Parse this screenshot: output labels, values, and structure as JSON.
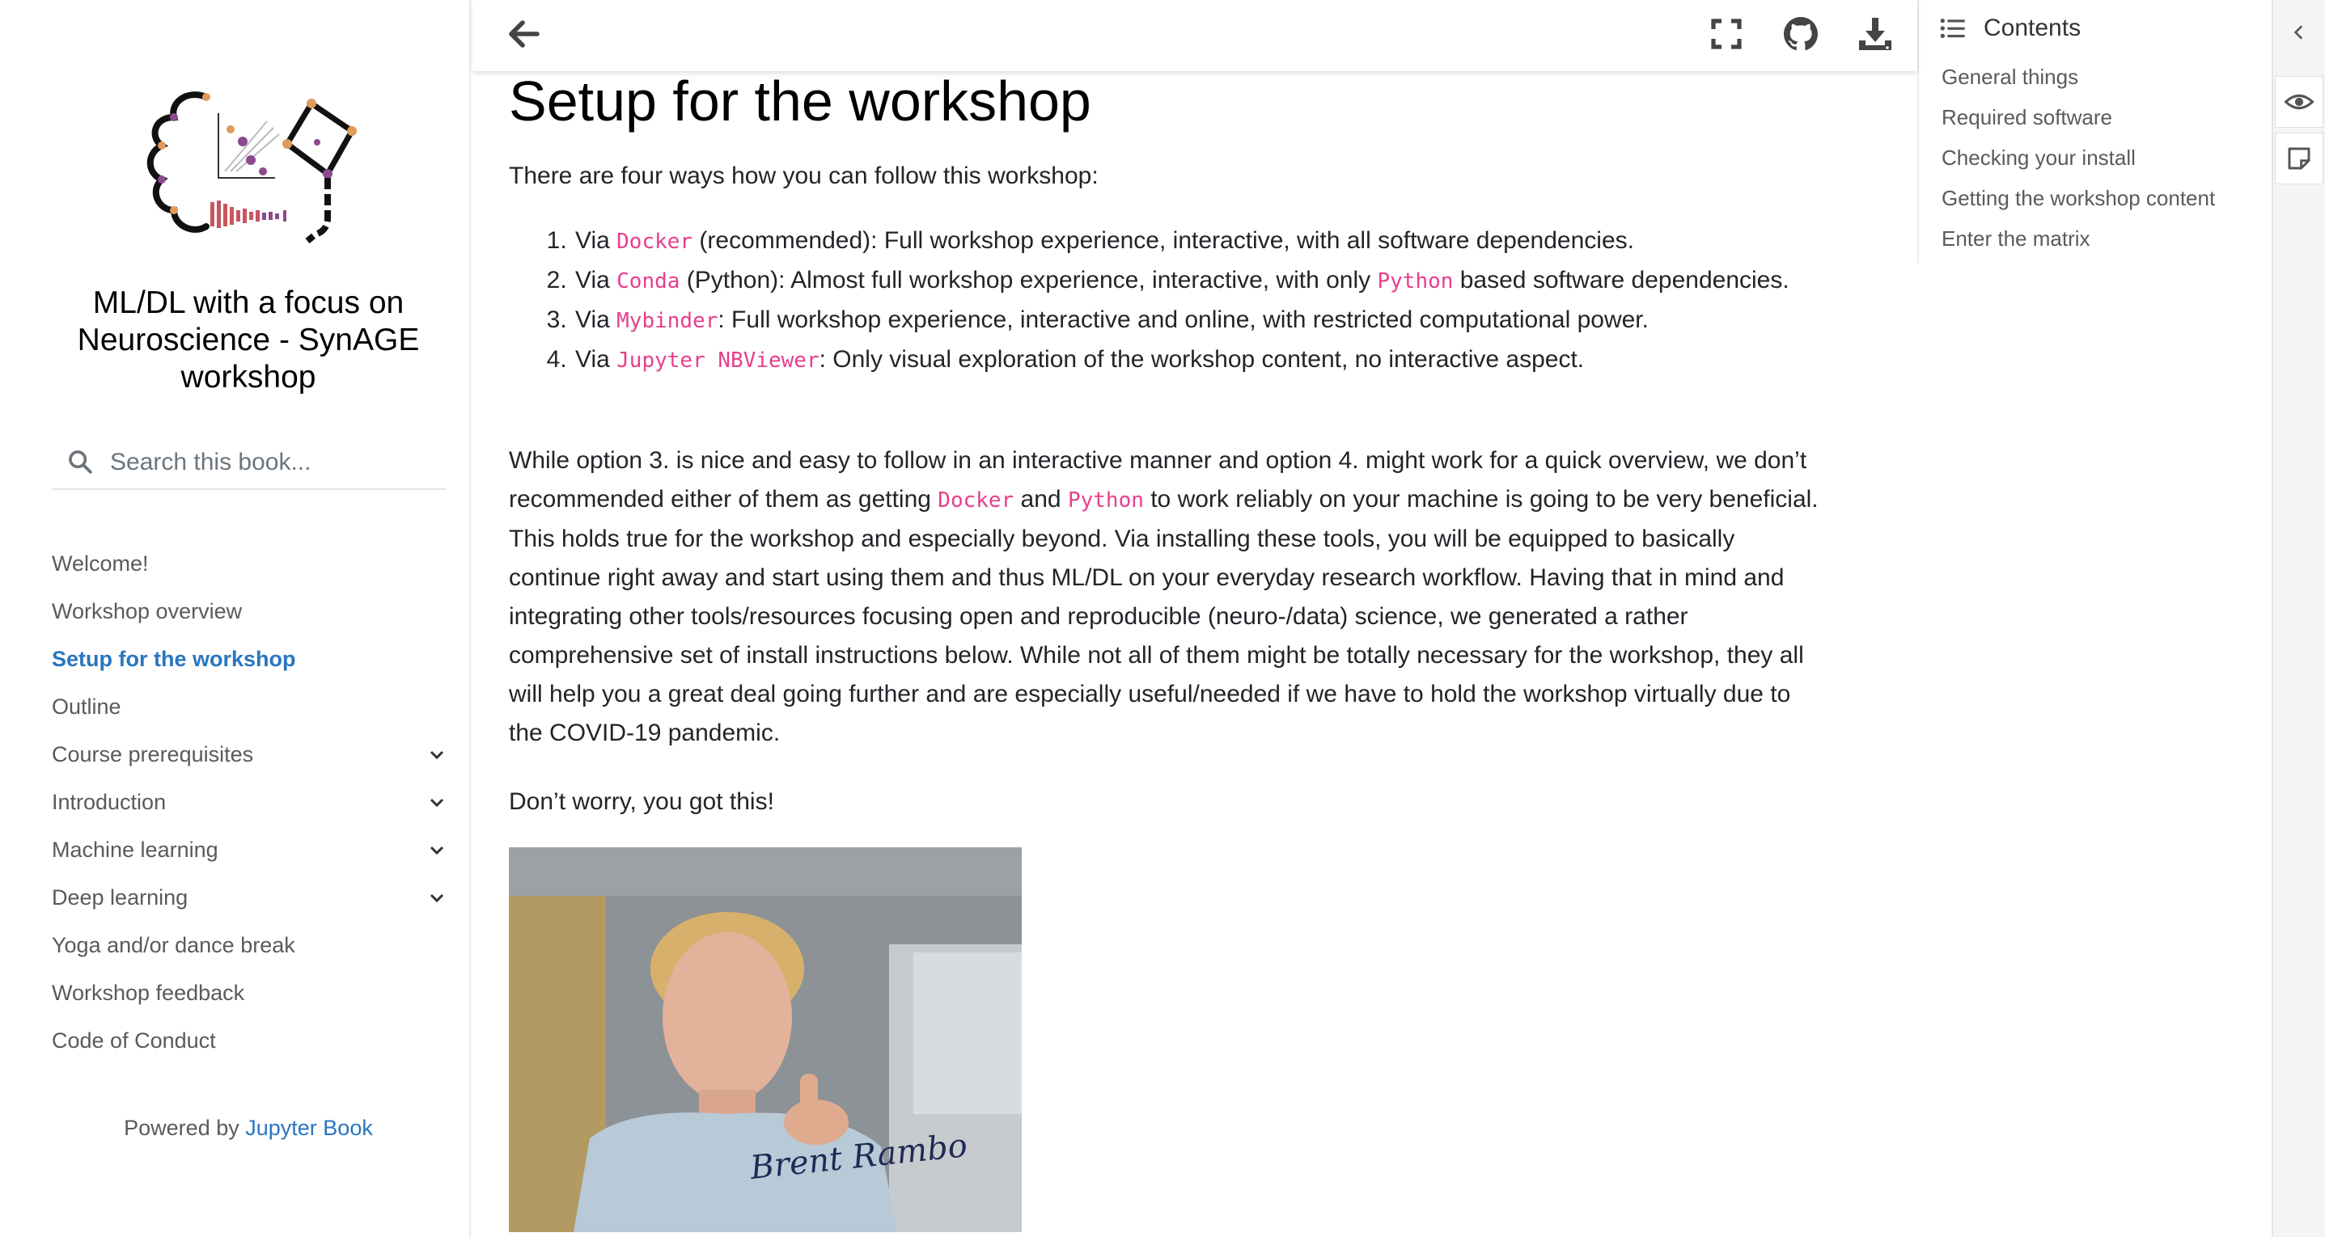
{
  "book": {
    "title": "ML/DL with a focus on Neuroscience - SynAGE workshop",
    "search_placeholder": "Search this book...",
    "powered_prefix": "Powered by",
    "powered_link": "Jupyter Book"
  },
  "nav": [
    {
      "label": "Welcome!",
      "active": false,
      "expandable": false
    },
    {
      "label": "Workshop overview",
      "active": false,
      "expandable": false
    },
    {
      "label": "Setup for the workshop",
      "active": true,
      "expandable": false
    },
    {
      "label": "Outline",
      "active": false,
      "expandable": false
    },
    {
      "label": "Course prerequisites",
      "active": false,
      "expandable": true
    },
    {
      "label": "Introduction",
      "active": false,
      "expandable": true
    },
    {
      "label": "Machine learning",
      "active": false,
      "expandable": true
    },
    {
      "label": "Deep learning",
      "active": false,
      "expandable": true
    },
    {
      "label": "Yoga and/or dance break",
      "active": false,
      "expandable": false
    },
    {
      "label": "Workshop feedback",
      "active": false,
      "expandable": false
    },
    {
      "label": "Code of Conduct",
      "active": false,
      "expandable": false
    }
  ],
  "toolbar": {
    "back_icon": "arrow-left-icon",
    "fullscreen_icon": "fullscreen-icon",
    "github_icon": "github-icon",
    "download_icon": "download-icon"
  },
  "content": {
    "heading": "Setup for the workshop",
    "intro": "There are four ways how you can follow this workshop:",
    "ways": [
      {
        "pre": "Via ",
        "code": "Docker",
        "post": " (recommended): Full workshop experience, interactive, with all software dependencies."
      },
      {
        "pre": "Via ",
        "code": "Conda",
        "post": " (Python): Almost full workshop experience, interactive, with only ",
        "code2": "Python",
        "post2": " based software dependencies."
      },
      {
        "pre": "Via ",
        "code": "Mybinder",
        "post": ": Full workshop experience, interactive and online, with restricted computational power."
      },
      {
        "pre": "Via ",
        "code": "Jupyter NBViewer",
        "post": ": Only visual exploration of the workshop content, no interactive aspect."
      }
    ],
    "para2_a": "While option 3. is nice and easy to follow in an interactive manner and option 4. might work for a quick overview, we don’t recommended either of them as getting ",
    "para2_code1": "Docker",
    "para2_b": " and ",
    "para2_code2": "Python",
    "para2_c": " to work reliably on your machine is going to be very beneficial. This holds true for the workshop and especially beyond. Via installing these tools, you will be equipped to basically continue right away and start using them and thus ML/DL on your everyday research workflow. Having that in mind and integrating other tools/resources focusing open and reproducible (neuro-/data) science, we generated a rather comprehensive set of install instructions below. While not all of them might be totally necessary for the workshop, they all will help you a great deal going further and are especially useful/needed if we have to hold the workshop virtually due to the COVID-19 pandemic.",
    "para3": "Don’t worry, you got this!",
    "gif_signature": "Brent Rambo"
  },
  "toc": {
    "title": "Contents",
    "items": [
      "General things",
      "Required software",
      "Checking your install",
      "Getting the workshop content",
      "Enter the matrix"
    ]
  },
  "rail": {
    "collapse_icon": "chevron-left-icon",
    "eye_icon": "eye-icon",
    "note_icon": "sticky-note-icon"
  }
}
